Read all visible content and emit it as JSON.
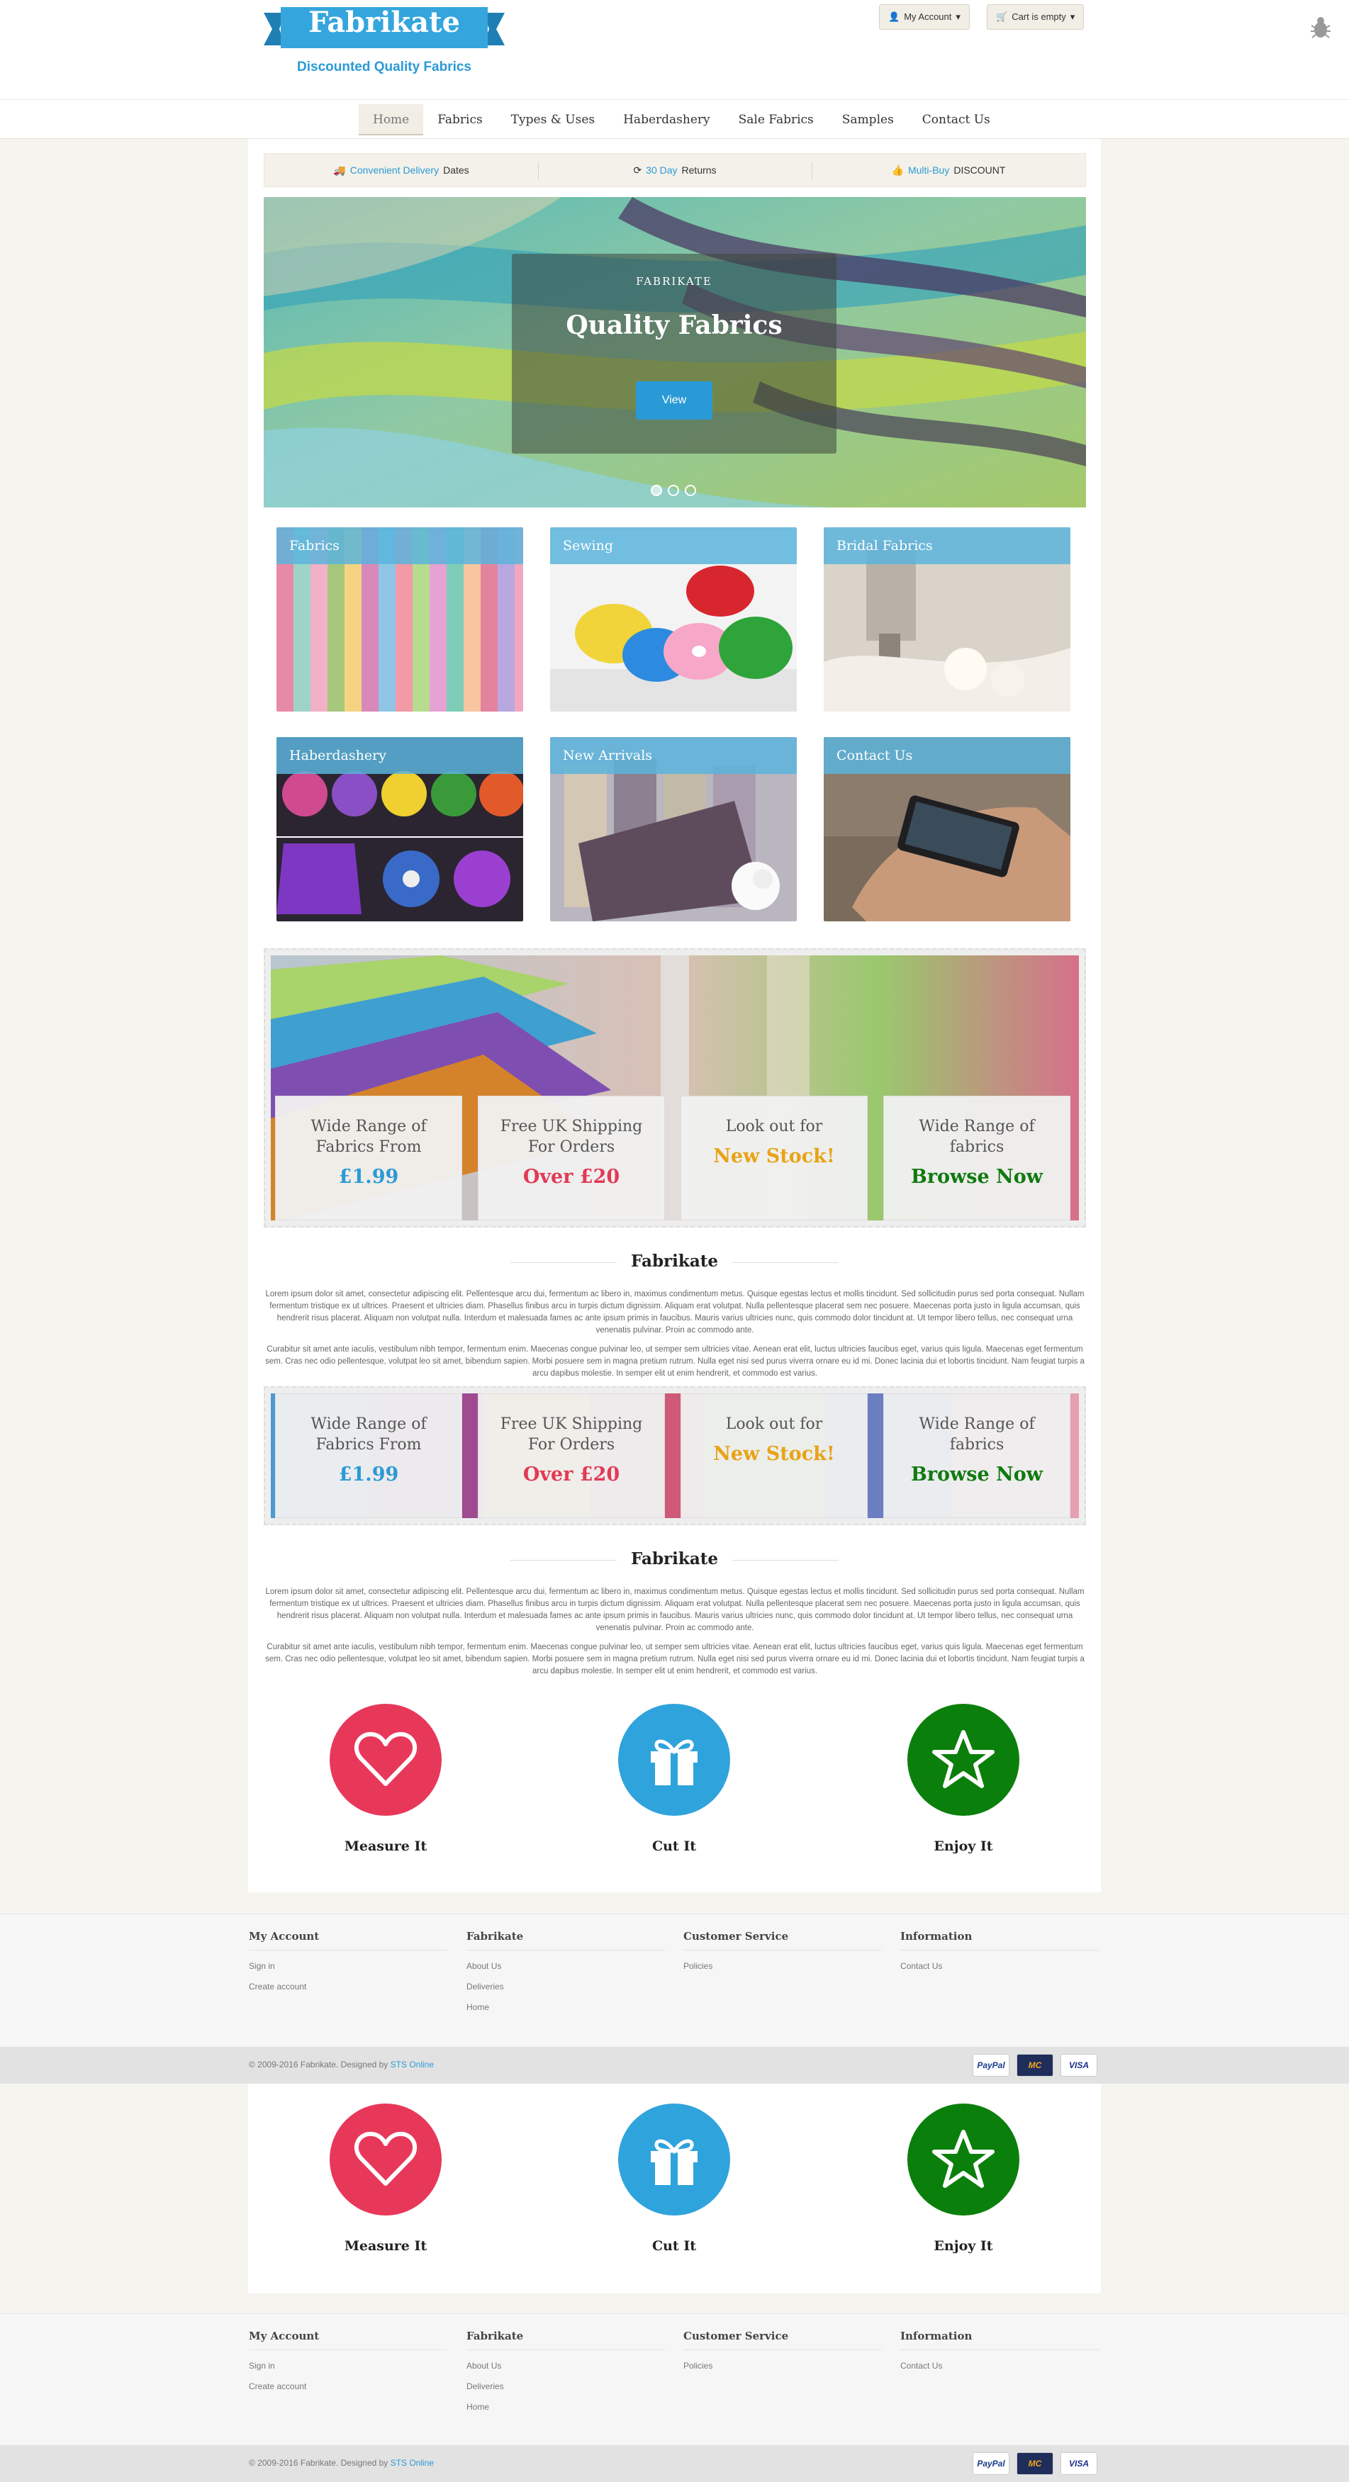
{
  "header": {
    "logo_title": "Fabrikate",
    "logo_subtitle": "Discounted Quality Fabrics",
    "my_account": "My Account",
    "cart": "Cart is empty"
  },
  "nav": {
    "items": [
      "Home",
      "Fabrics",
      "Types & Uses",
      "Haberdashery",
      "Sale Fabrics",
      "Samples",
      "Contact Us"
    ]
  },
  "infobar": {
    "delivery_highlight": "Convenient Delivery",
    "delivery_rest": "Dates",
    "returns_highlight": "30 Day",
    "returns_rest": "Returns",
    "multibuy_highlight": "Multi-Buy",
    "multibuy_rest": "DISCOUNT"
  },
  "slider": {
    "small": "FABRIKATE",
    "title": "Quality Fabrics",
    "button": "View"
  },
  "categories": [
    "Fabrics",
    "Sewing",
    "Bridal Fabrics",
    "Haberdashery",
    "New Arrivals",
    "Contact Us"
  ],
  "promos": [
    {
      "line1": "Wide Range of",
      "line2": "Fabrics From",
      "highlight": "£1.99",
      "color": "#2a9ad6"
    },
    {
      "line1": "Free UK Shipping",
      "line2": "For Orders",
      "highlight": "Over £20",
      "color": "#e23a55"
    },
    {
      "line1": "Look out for",
      "line2": "",
      "highlight": "New Stock!",
      "color": "#e8a316"
    },
    {
      "line1": "Wide Range of",
      "line2": "fabrics",
      "highlight": "Browse Now",
      "color": "#0f7a0f"
    }
  ],
  "section_title": "Fabrikate",
  "lorem1": "Lorem ipsum dolor sit amet, consectetur adipiscing elit. Pellentesque arcu dui, fermentum ac libero in, maximus condimentum metus. Quisque egestas lectus et mollis tincidunt. Sed sollicitudin purus sed porta consequat. Nullam fermentum tristique ex ut ultrices. Praesent et ultricies diam. Phasellus finibus arcu in turpis dictum dignissim. Aliquam erat volutpat. Nulla pellentesque placerat sem nec posuere. Maecenas porta justo in ligula accumsan, quis hendrerit risus placerat. Aliquam non volutpat nulla. Interdum et malesuada fames ac ante ipsum primis in faucibus. Mauris varius ultricies nunc, quis commodo dolor tincidunt at. Ut tempor libero tellus, nec consequat urna venenatis pulvinar. Proin ac commodo ante.",
  "lorem2": "Curabitur sit amet ante iaculis, vestibulum nibh tempor, fermentum enim. Maecenas congue pulvinar leo, ut semper sem ultricies vitae. Aenean erat elit, luctus ultricies faucibus eget, varius quis ligula. Maecenas eget fermentum sem. Cras nec odio pellentesque, volutpat leo sit amet, bibendum sapien. Morbi posuere sem in magna pretium rutrum. Nulla eget nisi sed purus viverra ornare eu id mi. Donec lacinia dui et lobortis tincidunt. Nam feugiat turpis a arcu dapibus molestie. In semper elit ut enim hendrerit, et commodo est varius.",
  "features": [
    {
      "label": "Measure It",
      "icon": "heart-icon",
      "color": "#e8385a"
    },
    {
      "label": "Cut It",
      "icon": "gift-icon",
      "color": "#2fa3dc"
    },
    {
      "label": "Enjoy It",
      "icon": "star-icon",
      "color": "#0b7f0b"
    }
  ],
  "footer": {
    "cols": [
      {
        "title": "My Account",
        "links": [
          "Sign in",
          "Create account"
        ]
      },
      {
        "title": "Fabrikate",
        "links": [
          "About Us",
          "Deliveries",
          "Home"
        ]
      },
      {
        "title": "Customer Service",
        "links": [
          "Policies"
        ]
      },
      {
        "title": "Information",
        "links": [
          "Contact Us"
        ]
      }
    ],
    "copyright": "© 2009-2016 Fabrikate.  Designed by",
    "designer": "STS Online",
    "cards": [
      "PayPal",
      "MC",
      "VISA"
    ]
  }
}
